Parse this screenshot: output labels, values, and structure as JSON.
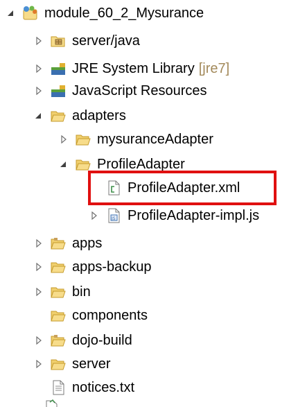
{
  "tree": {
    "project": {
      "label": "module_60_2_Mysurance",
      "icon": "project-icon",
      "expanded": true
    },
    "server_java": {
      "label": "server/java",
      "icon": "package-folder-icon",
      "expanded": false
    },
    "jre_library": {
      "label": "JRE System Library",
      "decoration": "[jre7]",
      "icon": "library-icon",
      "expanded": false
    },
    "javascript_resources": {
      "label": "JavaScript Resources",
      "icon": "library-icon",
      "expanded": false
    },
    "adapters": {
      "label": "adapters",
      "icon": "folder-icon",
      "expanded": true
    },
    "mysurance_adapter": {
      "label": "mysuranceAdapter",
      "icon": "folder-icon",
      "expanded": false
    },
    "profile_adapter": {
      "label": "ProfileAdapter",
      "icon": "folder-icon",
      "expanded": true
    },
    "profile_adapter_xml": {
      "label": "ProfileAdapter.xml",
      "icon": "xml-file-icon",
      "selected": true
    },
    "profile_adapter_impl": {
      "label": "ProfileAdapter-impl.js",
      "icon": "js-file-icon",
      "expanded": false
    },
    "apps": {
      "label": "apps",
      "icon": "folder-icon",
      "expanded": false
    },
    "apps_backup": {
      "label": "apps-backup",
      "icon": "folder-icon",
      "expanded": false
    },
    "bin": {
      "label": "bin",
      "icon": "folder-icon",
      "expanded": false
    },
    "components": {
      "label": "components",
      "icon": "folder-icon"
    },
    "dojo_build": {
      "label": "dojo-build",
      "icon": "folder-icon",
      "expanded": false
    },
    "server": {
      "label": "server",
      "icon": "folder-icon",
      "expanded": false
    },
    "notices": {
      "label": "notices.txt",
      "icon": "text-file-icon"
    }
  },
  "colors": {
    "folder_fill": "#f7dc8a",
    "folder_stroke": "#c69b2c",
    "highlight": "#e01010",
    "decoration": "#a38a5b"
  }
}
